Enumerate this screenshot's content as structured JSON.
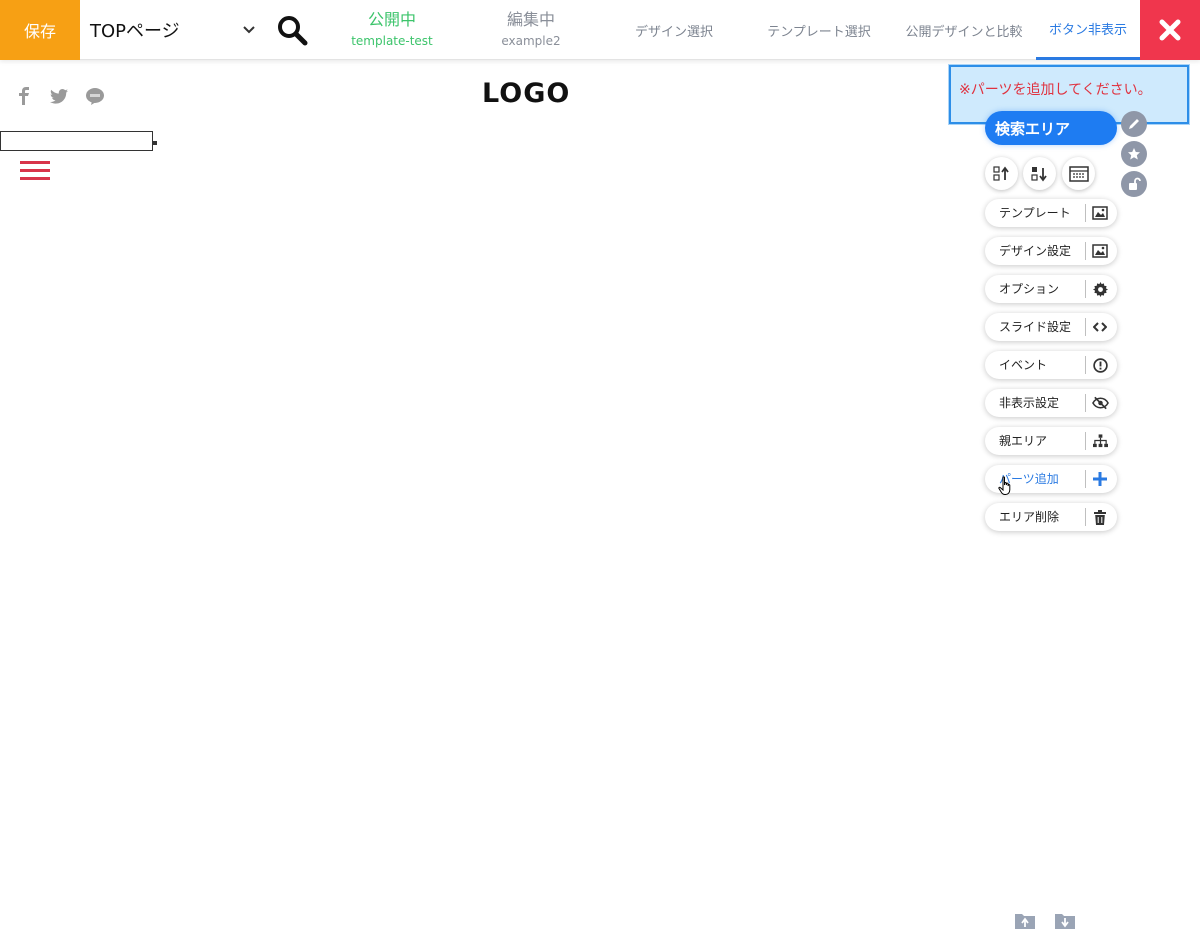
{
  "toolbar": {
    "save_label": "保存",
    "page_select_value": "TOPページ",
    "status_public": {
      "title": "公開中",
      "name": "template-test"
    },
    "status_editing": {
      "title": "編集中",
      "name": "example2"
    },
    "design_select": "デザイン選択",
    "template_select": "テンプレート選択",
    "compare_public": "公開デザインと比較",
    "hide_buttons": "ボタン非表示"
  },
  "page": {
    "logo_text": "LOGO",
    "social_icons": [
      "facebook-icon",
      "twitter-icon",
      "line-icon"
    ]
  },
  "editor": {
    "notice": "※パーツを追加してください。",
    "area_title": "検索エリア",
    "menu_items": [
      {
        "label": "テンプレート",
        "icon": "image-icon"
      },
      {
        "label": "デザイン設定",
        "icon": "image-icon"
      },
      {
        "label": "オプション",
        "icon": "gear-icon"
      },
      {
        "label": "スライド設定",
        "icon": "code-icon"
      },
      {
        "label": "イベント",
        "icon": "alert-icon"
      },
      {
        "label": "非表示設定",
        "icon": "eye-slash-icon"
      },
      {
        "label": "親エリア",
        "icon": "sitemap-icon"
      },
      {
        "label": "パーツ追加",
        "icon": "plus-icon"
      },
      {
        "label": "エリア削除",
        "icon": "trash-icon"
      }
    ]
  },
  "colors": {
    "save": "#f7a014",
    "public": "#3cc46b",
    "accent": "#2a7ae2",
    "close": "#f0364d",
    "area_title": "#1e7cf2",
    "notice_text": "#e0323f"
  }
}
